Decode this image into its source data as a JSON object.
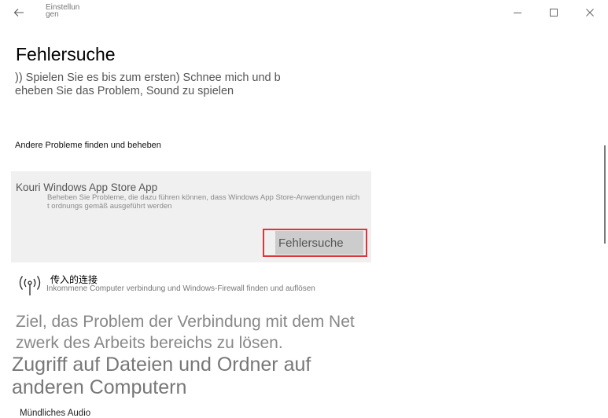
{
  "window": {
    "title": "Einstellungen"
  },
  "page": {
    "title": "Fehlersuche",
    "description": ")) Spielen Sie es bis zum ersten) Schnee mich und beheben Sie das Problem, Sound zu spielen"
  },
  "section": {
    "heading": "Andere Probleme finden und beheben"
  },
  "card": {
    "title": "Kouri Windows App Store App",
    "description": "Beheben Sie Probleme, die dazu führen können, dass Windows App Store-Anwendungen nicht ordnungs gemäß ausgeführt werden",
    "button_label": "Fehlersuche"
  },
  "item": {
    "title": "传入的连接",
    "description": "Inkommene Computer verbindung und Windows-Firewall finden und auflösen",
    "icon": "antenna-icon"
  },
  "text_blocks": {
    "network_text": "Ziel, das Problem der Verbindung mit dem Netzwerk des Arbeits bereichs zu lösen.",
    "files_text": "Zugriff auf Dateien und Ordner auf anderen Computern"
  },
  "bottom_item": {
    "label": "Mündliches Audio"
  },
  "colors": {
    "highlight_border": "#d9363e",
    "card_background": "#f0f0f0",
    "button_background": "#cccccc"
  }
}
